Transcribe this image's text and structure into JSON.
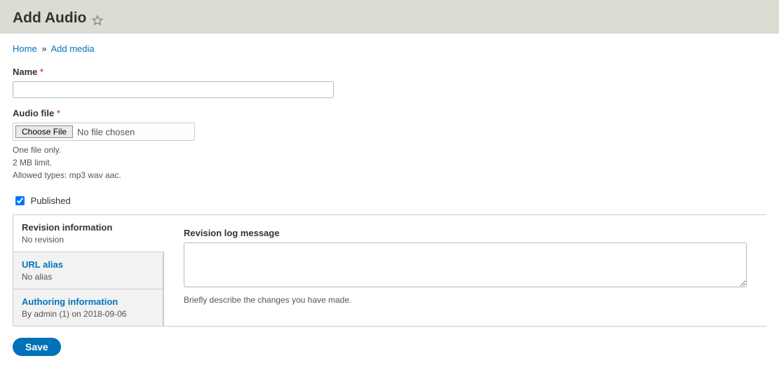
{
  "header": {
    "title": "Add Audio"
  },
  "breadcrumb": {
    "home": "Home",
    "add_media": "Add media"
  },
  "form": {
    "name_label": "Name",
    "name_value": "",
    "audio_label": "Audio file",
    "choose_file_label": "Choose File",
    "file_status": "No file chosen",
    "desc_line1": "One file only.",
    "desc_line2": "2 MB limit.",
    "desc_line3": "Allowed types: mp3 wav aac.",
    "published_label": "Published",
    "published_checked": "checked"
  },
  "tabs": {
    "revision": {
      "title": "Revision information",
      "summary": "No revision"
    },
    "url": {
      "title": "URL alias",
      "summary": "No alias"
    },
    "author": {
      "title": "Authoring information",
      "summary": "By admin (1) on 2018-09-06"
    }
  },
  "pane": {
    "log_label": "Revision log message",
    "log_value": "",
    "log_help": "Briefly describe the changes you have made."
  },
  "actions": {
    "save": "Save"
  }
}
